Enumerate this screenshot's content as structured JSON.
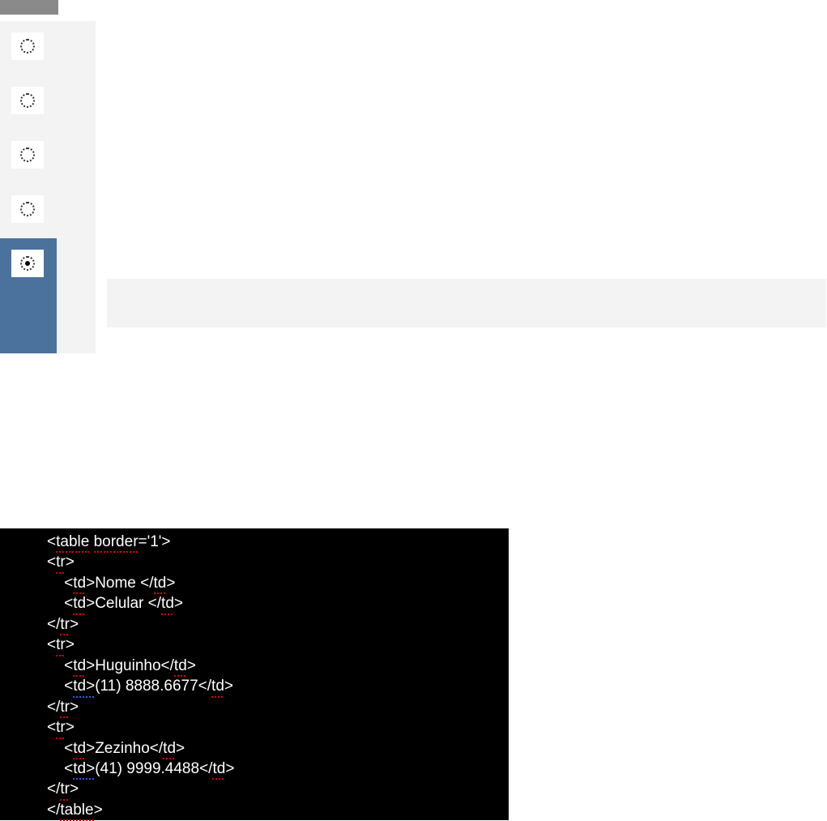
{
  "sidebar": {
    "items": [
      {
        "icon": "spinner-icon"
      },
      {
        "icon": "spinner-icon"
      },
      {
        "icon": "spinner-icon"
      },
      {
        "icon": "spinner-icon"
      },
      {
        "icon": "spinner-active-icon"
      }
    ],
    "active_index": 4
  },
  "code": {
    "lines": [
      {
        "pre": "",
        "parts": [
          {
            "t": "<",
            "k": "g"
          },
          {
            "t": "table",
            "k": "spell"
          },
          {
            "t": " ",
            "k": "g"
          },
          {
            "t": "border",
            "k": "spell"
          },
          {
            "t": "='1'>",
            "k": "g"
          }
        ]
      },
      {
        "pre": "",
        "parts": [
          {
            "t": "<",
            "k": "g"
          },
          {
            "t": "tr",
            "k": "spell"
          },
          {
            "t": ">",
            "k": "g"
          }
        ]
      },
      {
        "pre": "    ",
        "parts": [
          {
            "t": "<",
            "k": "g"
          },
          {
            "t": "td",
            "k": "spell"
          },
          {
            "t": ">Nome </",
            "k": "g"
          },
          {
            "t": "td",
            "k": "spell"
          },
          {
            "t": ">",
            "k": "g"
          }
        ]
      },
      {
        "pre": "    ",
        "parts": [
          {
            "t": "<",
            "k": "g"
          },
          {
            "t": "td",
            "k": "spell"
          },
          {
            "t": ">Celular </",
            "k": "g"
          },
          {
            "t": "td",
            "k": "spell"
          },
          {
            "t": ">",
            "k": "g"
          }
        ]
      },
      {
        "pre": "",
        "parts": [
          {
            "t": "</",
            "k": "g"
          },
          {
            "t": "tr",
            "k": "spell"
          },
          {
            "t": ">",
            "k": "g"
          }
        ]
      },
      {
        "pre": "",
        "parts": [
          {
            "t": "<",
            "k": "g"
          },
          {
            "t": "tr",
            "k": "spell"
          },
          {
            "t": ">",
            "k": "g"
          }
        ]
      },
      {
        "pre": "    ",
        "parts": [
          {
            "t": "<",
            "k": "g"
          },
          {
            "t": "td",
            "k": "spell"
          },
          {
            "t": ">Huguinho</",
            "k": "g"
          },
          {
            "t": "td",
            "k": "spell"
          },
          {
            "t": ">",
            "k": "g"
          }
        ]
      },
      {
        "pre": "    ",
        "parts": [
          {
            "t": "<",
            "k": "g"
          },
          {
            "t": "td>",
            "k": "gram"
          },
          {
            "t": "(11) 8888.6677</",
            "k": "g"
          },
          {
            "t": "td",
            "k": "spell"
          },
          {
            "t": ">",
            "k": "g"
          }
        ]
      },
      {
        "pre": "",
        "parts": [
          {
            "t": "</",
            "k": "g"
          },
          {
            "t": "tr",
            "k": "spell"
          },
          {
            "t": ">",
            "k": "g"
          }
        ]
      },
      {
        "pre": "",
        "parts": [
          {
            "t": "<",
            "k": "g"
          },
          {
            "t": "tr",
            "k": "spell"
          },
          {
            "t": ">",
            "k": "g"
          }
        ]
      },
      {
        "pre": "    ",
        "parts": [
          {
            "t": "<",
            "k": "g"
          },
          {
            "t": "td",
            "k": "spell"
          },
          {
            "t": ">Zezinho</",
            "k": "g"
          },
          {
            "t": "td",
            "k": "spell"
          },
          {
            "t": ">",
            "k": "g"
          }
        ]
      },
      {
        "pre": "    ",
        "parts": [
          {
            "t": "<",
            "k": "g"
          },
          {
            "t": "td>",
            "k": "gram"
          },
          {
            "t": "(41) 9999.4488</",
            "k": "g"
          },
          {
            "t": "td",
            "k": "spell"
          },
          {
            "t": ">",
            "k": "g"
          }
        ]
      },
      {
        "pre": "",
        "parts": [
          {
            "t": "</",
            "k": "g"
          },
          {
            "t": "tr",
            "k": "spell"
          },
          {
            "t": ">",
            "k": "g"
          }
        ]
      },
      {
        "pre": "",
        "parts": [
          {
            "t": "</",
            "k": "g"
          },
          {
            "t": "table",
            "k": "spell"
          },
          {
            "t": ">",
            "k": "g"
          }
        ]
      }
    ]
  }
}
